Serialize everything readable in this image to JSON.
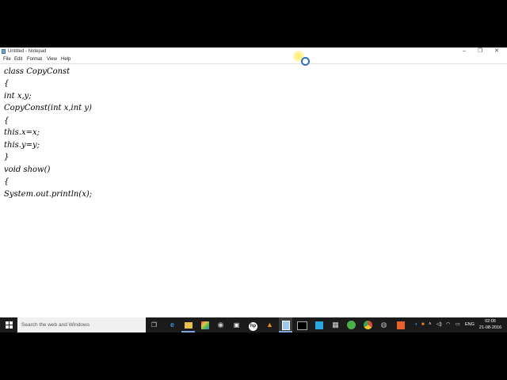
{
  "window": {
    "title": "Untitled - Notepad",
    "controls": {
      "minimize": "‒",
      "maximize": "❐",
      "close": "✕"
    }
  },
  "menu": [
    "File",
    "Edit",
    "Format",
    "View",
    "Help"
  ],
  "editor": {
    "lines": [
      "class CopyConst",
      "{",
      "int x,y;",
      "CopyConst(int x,int y)",
      "{",
      "this.x=x;",
      "this.y=y;",
      "}",
      "void show()",
      "{",
      "System.out.println(x);"
    ]
  },
  "taskbar": {
    "search_placeholder": "Search the web and Windows",
    "pinned_icons": [
      "task-view-icon",
      "edge-icon",
      "file-explorer-icon",
      "paint-icon",
      "webcam-icon",
      "store-icon",
      "hp-icon",
      "vlc-icon",
      "notepad-icon",
      "cmd-icon",
      "photos-icon",
      "calculator-icon",
      "utorrent-icon",
      "chrome-icon",
      "browser-icon",
      "office-icon"
    ],
    "tray": {
      "lang": "ENG",
      "time": "02:05",
      "date": "21-08-2016"
    }
  },
  "colors": {
    "taskbar_bg": "#1b1b1b",
    "search_bg": "#f0f0f0",
    "accent": "#7aa6d8"
  }
}
